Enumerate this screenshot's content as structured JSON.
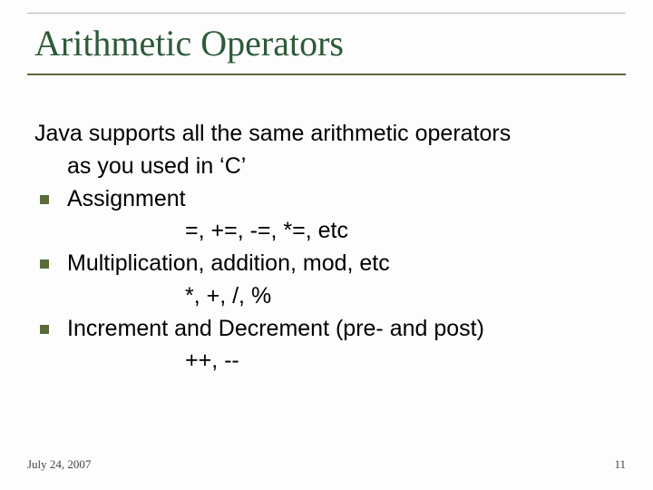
{
  "title": "Arithmetic Operators",
  "intro_line1": "Java supports all the same arithmetic operators",
  "intro_line2": "as you used in ‘C’",
  "items": [
    {
      "label": "Assignment",
      "sub": "=, +=, -=, *=, etc"
    },
    {
      "label": "Multiplication, addition, mod, etc",
      "sub": "*, +, /, %"
    },
    {
      "label": "Increment and Decrement (pre- and post)",
      "sub": "++, --"
    }
  ],
  "footer": {
    "date": "July 24, 2007",
    "page": "11"
  }
}
